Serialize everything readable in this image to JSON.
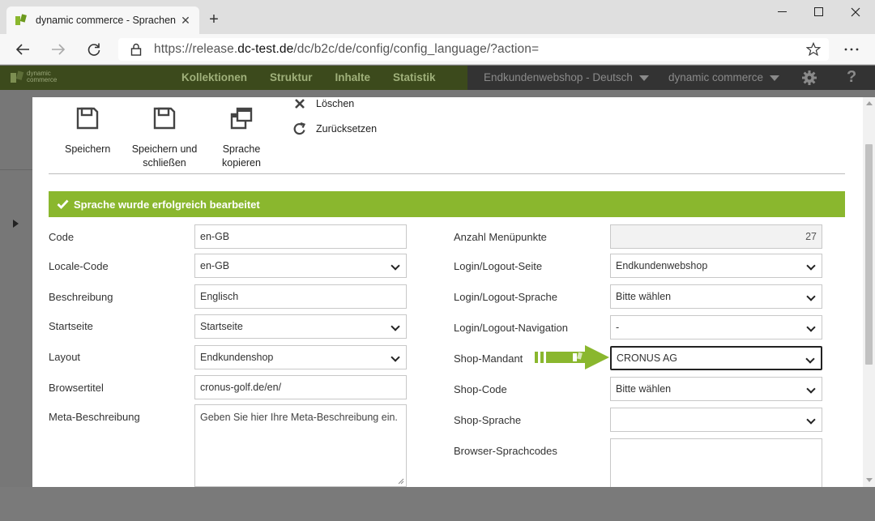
{
  "browser": {
    "tab_title": "dynamic commerce - Sprachen",
    "new_tab_label": "+",
    "url_prefix": "https://release.",
    "url_domain": "dc-test.de",
    "url_path": "/dc/b2c/de/config/config_language/?action=",
    "icons": [
      "favicon",
      "close-icon",
      "back-icon",
      "forward-icon",
      "reload-icon",
      "lock-icon",
      "star-icon",
      "more-icon",
      "minimize-icon",
      "maximize-icon",
      "window-close-icon"
    ]
  },
  "app_header": {
    "logo_text_1": "dynamic",
    "logo_text_2": "commerce",
    "nav": [
      "Kollektionen",
      "Struktur",
      "Inhalte",
      "Statistik"
    ],
    "shop_select": "Endkundenwebshop - Deutsch",
    "company_select": "dynamic commerce",
    "help_label": "?",
    "colors": {
      "header_green": "#8ab72e",
      "header_dark": "#333333"
    }
  },
  "toolbar": {
    "save_label": "Speichern",
    "save_close_label_1": "Speichern und",
    "save_close_label_2": "schließen",
    "copy_label_1": "Sprache",
    "copy_label_2": "kopieren",
    "delete_label": "Löschen",
    "reset_label": "Zurücksetzen"
  },
  "alert": {
    "message": "Sprache wurde erfolgreich bearbeitet",
    "color": "#8ab72e"
  },
  "form_left": {
    "code_label": "Code",
    "code_value": "en-GB",
    "locale_label": "Locale-Code",
    "locale_value": "en-GB",
    "description_label": "Beschreibung",
    "description_value": "Englisch",
    "startpage_label": "Startseite",
    "startpage_value": "Startseite",
    "layout_label": "Layout",
    "layout_value": "Endkundenshop",
    "browsertitle_label": "Browsertitel",
    "browsertitle_value": "cronus-golf.de/en/",
    "meta_label": "Meta-Beschreibung",
    "meta_placeholder": "Geben Sie hier Ihre Meta-Beschreibung ein."
  },
  "form_right": {
    "menu_count_label": "Anzahl Menüpunkte",
    "menu_count_value": "27",
    "login_page_label": "Login/Logout-Seite",
    "login_page_value": "Endkundenwebshop",
    "login_lang_label": "Login/Logout-Sprache",
    "login_lang_value": "Bitte wählen",
    "login_nav_label": "Login/Logout-Navigation",
    "login_nav_value": "-",
    "mandant_label": "Shop-Mandant",
    "mandant_value": "CRONUS AG",
    "shopcode_label": "Shop-Code",
    "shopcode_value": "Bitte wählen",
    "shoplang_label": "Shop-Sprache",
    "shoplang_value": "",
    "browser_codes_label": "Browser-Sprachcodes",
    "browser_codes_value": ""
  }
}
